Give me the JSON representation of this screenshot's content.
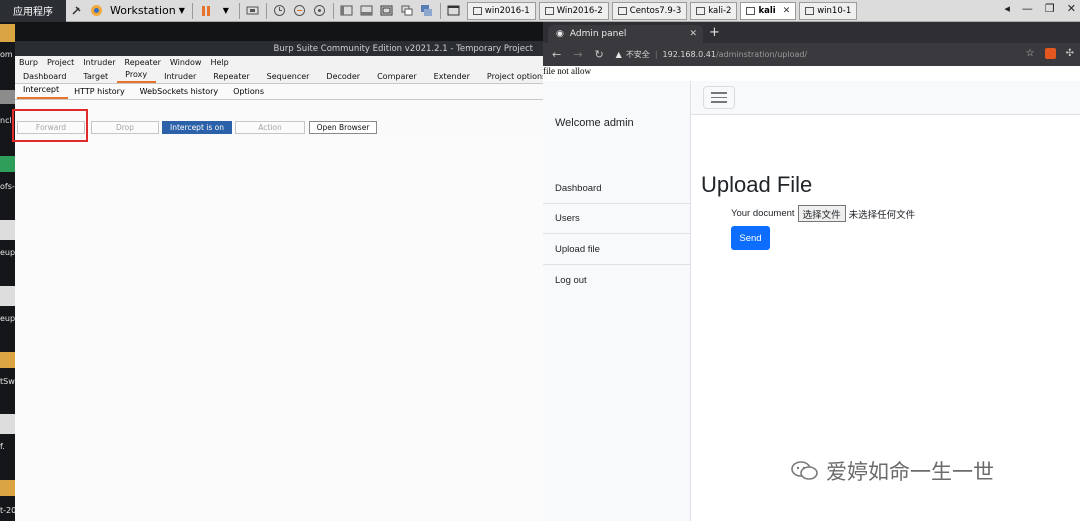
{
  "vmware": {
    "apps_label": "应用程序",
    "workstation_label": "Workstation",
    "tabs": [
      {
        "label": "win2016-1"
      },
      {
        "label": "Win2016-2"
      },
      {
        "label": "Centos7.9-3"
      },
      {
        "label": "kali-2"
      },
      {
        "label": "kali"
      },
      {
        "label": "win10-1"
      }
    ]
  },
  "desktop": {
    "icons": [
      "ncl",
      "om",
      "ofs-",
      "eup",
      "eup",
      "tSw",
      "f.",
      "t-20"
    ]
  },
  "burp": {
    "title": "Burp Suite Community Edition v2021.2.1 - Temporary Project",
    "menu": [
      "Burp",
      "Project",
      "Intruder",
      "Repeater",
      "Window",
      "Help"
    ],
    "tabs": [
      "Dashboard",
      "Target",
      "Proxy",
      "Intruder",
      "Repeater",
      "Sequencer",
      "Decoder",
      "Comparer",
      "Extender",
      "Project options"
    ],
    "active_tab": "Proxy",
    "subtabs": [
      "Intercept",
      "HTTP history",
      "WebSockets history",
      "Options"
    ],
    "buttons": {
      "forward": "Forward",
      "drop": "Drop",
      "intercept": "Intercept is on",
      "action": "Action",
      "open_browser": "Open Browser"
    }
  },
  "chrome": {
    "tab_title": "Admin panel",
    "security_label": "不安全",
    "url_host": "192.168.0.41",
    "url_path": "/adminstration/upload/"
  },
  "page": {
    "alert_text": "file not allow",
    "welcome": "Welcome admin",
    "sidebar": [
      "Dashboard",
      "Users",
      "Upload file",
      "Log out"
    ],
    "heading": "Upload File",
    "doc_label": "Your document",
    "choose_file": "选择文件",
    "no_file": "未选择任何文件",
    "send": "Send"
  },
  "watermark": {
    "text": "爱婷如命一生一世"
  },
  "colors": {
    "burp_accent": "#e8742b",
    "intercept_on": "#2b61a8",
    "send_button": "#0d6efd",
    "highlight_box": "#e12a2a"
  }
}
